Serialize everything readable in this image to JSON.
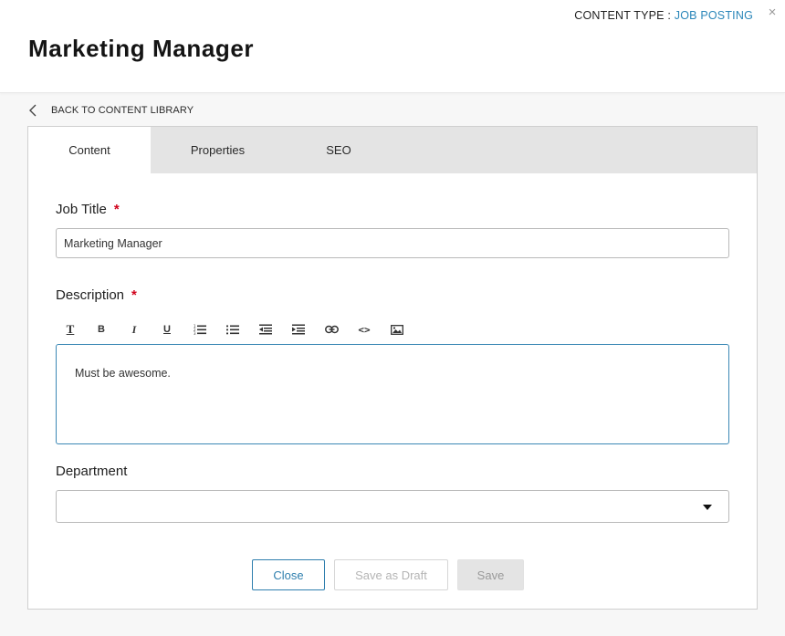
{
  "header": {
    "title": "Marketing Manager",
    "content_type_label": "CONTENT TYPE : ",
    "content_type_value": "JOB POSTING",
    "close_glyph": "×"
  },
  "back_link": {
    "label": "BACK TO CONTENT LIBRARY"
  },
  "tabs": [
    {
      "label": "Content",
      "active": true
    },
    {
      "label": "Properties",
      "active": false
    },
    {
      "label": "SEO",
      "active": false
    }
  ],
  "form": {
    "job_title": {
      "label": "Job Title",
      "required_mark": "*",
      "value": "Marketing Manager"
    },
    "description": {
      "label": "Description",
      "required_mark": "*",
      "value": "Must be awesome.",
      "toolbar": [
        {
          "name": "text-style-icon",
          "glyph": "T"
        },
        {
          "name": "bold-icon",
          "glyph": "B"
        },
        {
          "name": "italic-icon",
          "glyph": "I"
        },
        {
          "name": "underline-icon",
          "glyph": "U"
        },
        {
          "name": "ordered-list-icon",
          "glyph": ""
        },
        {
          "name": "unordered-list-icon",
          "glyph": ""
        },
        {
          "name": "outdent-icon",
          "glyph": ""
        },
        {
          "name": "indent-icon",
          "glyph": ""
        },
        {
          "name": "link-icon",
          "glyph": ""
        },
        {
          "name": "code-icon",
          "glyph": "<>"
        },
        {
          "name": "image-icon",
          "glyph": ""
        }
      ]
    },
    "department": {
      "label": "Department",
      "value": ""
    }
  },
  "actions": {
    "close_label": "Close",
    "draft_label": "Save as Draft",
    "save_label": "Save"
  },
  "colors": {
    "accent": "#2a86b9",
    "required": "#d0021b",
    "tab_bar": "#e4e4e4"
  }
}
